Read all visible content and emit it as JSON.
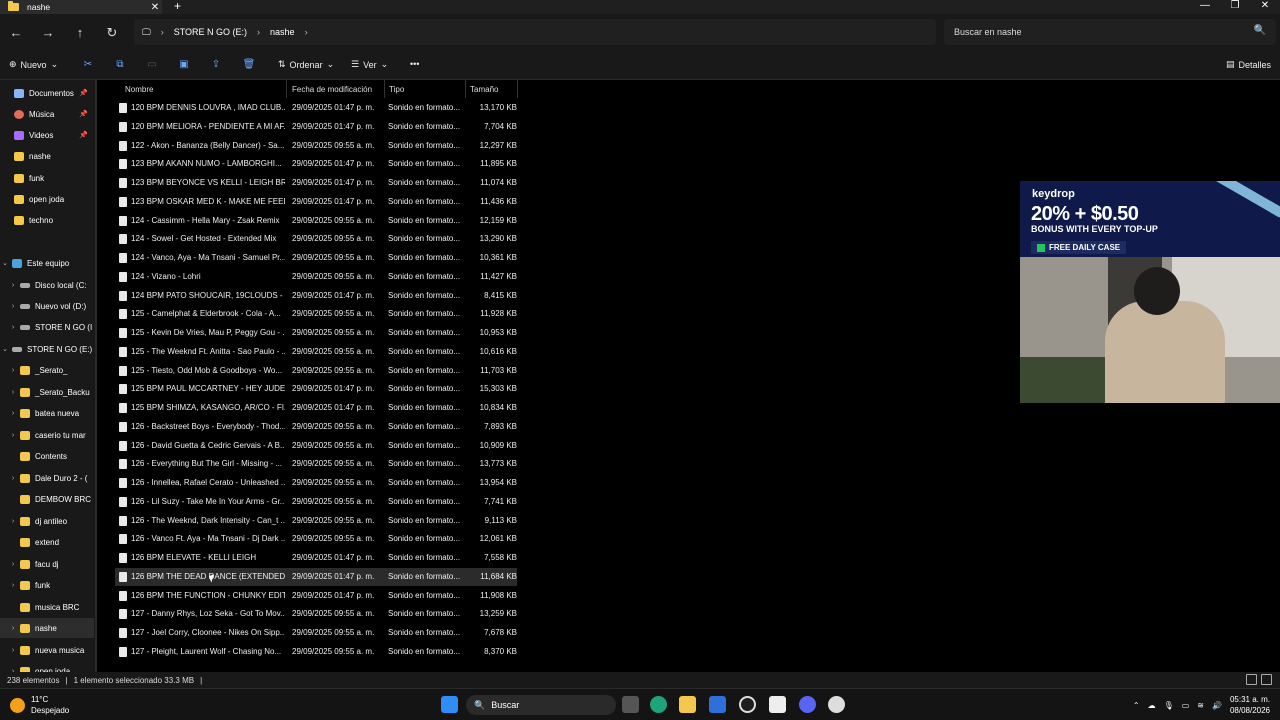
{
  "window": {
    "tab_title": "nashe",
    "tab_close": "✕",
    "new_tab": "+",
    "minimize": "—",
    "maximize": "❐",
    "close": "✕"
  },
  "navbar": {
    "back": "←",
    "forward": "→",
    "up": "↑",
    "refresh": "↻",
    "pc_icon": "🖵",
    "breadcrumb": [
      "STORE N GO (E:)",
      "nashe"
    ],
    "chevron": "›",
    "search_placeholder": "Buscar en nashe",
    "search_icon": "🔍"
  },
  "toolbar": {
    "nuevo": "Nuevo",
    "ordenar": "Ordenar",
    "ver": "Ver",
    "more": "•••",
    "detalles": "Detalles",
    "icons": [
      "cut-icon",
      "copy-icon",
      "paste-icon",
      "rename-icon",
      "share-icon",
      "delete-icon"
    ]
  },
  "sidebar": {
    "items": [
      {
        "label": "Documentos",
        "icon": "doc",
        "pin": true,
        "chev": ""
      },
      {
        "label": "Música",
        "icon": "mus",
        "pin": true,
        "chev": ""
      },
      {
        "label": "Videos",
        "icon": "vid",
        "pin": true,
        "chev": ""
      },
      {
        "label": "nashe",
        "icon": "fold",
        "pin": false,
        "chev": ""
      },
      {
        "label": "funk",
        "icon": "fold",
        "pin": false,
        "chev": ""
      },
      {
        "label": "open joda",
        "icon": "fold",
        "pin": false,
        "chev": ""
      },
      {
        "label": "techno",
        "icon": "fold",
        "pin": false,
        "chev": ""
      },
      {
        "label": "Este equipo",
        "icon": "pc",
        "pin": false,
        "chev": "⌄"
      },
      {
        "label": "Disco local (C:",
        "icon": "drv",
        "pin": false,
        "chev": "›"
      },
      {
        "label": "Nuevo vol (D:)",
        "icon": "drv",
        "pin": false,
        "chev": "›"
      },
      {
        "label": "STORE N GO (I",
        "icon": "drv",
        "pin": false,
        "chev": "›"
      },
      {
        "label": "STORE N GO (E:)",
        "icon": "drv",
        "pin": false,
        "chev": "⌄"
      },
      {
        "label": "_Serato_",
        "icon": "fold",
        "pin": false,
        "chev": "›"
      },
      {
        "label": "_Serato_Backu",
        "icon": "fold",
        "pin": false,
        "chev": "›"
      },
      {
        "label": "batea nueva",
        "icon": "fold",
        "pin": false,
        "chev": "›"
      },
      {
        "label": "caserio tu mar",
        "icon": "fold",
        "pin": false,
        "chev": "›"
      },
      {
        "label": "Contents",
        "icon": "fold",
        "pin": false,
        "chev": ""
      },
      {
        "label": "Dale Duro 2 - (",
        "icon": "fold",
        "pin": false,
        "chev": "›"
      },
      {
        "label": "DEMBOW BRC",
        "icon": "fold",
        "pin": false,
        "chev": ""
      },
      {
        "label": "dj antileo",
        "icon": "fold",
        "pin": false,
        "chev": "›"
      },
      {
        "label": "extend",
        "icon": "fold",
        "pin": false,
        "chev": ""
      },
      {
        "label": "facu dj",
        "icon": "fold",
        "pin": false,
        "chev": "›"
      },
      {
        "label": "funk",
        "icon": "fold",
        "pin": false,
        "chev": "›"
      },
      {
        "label": "musica BRC",
        "icon": "fold",
        "pin": false,
        "chev": ""
      },
      {
        "label": "nashe",
        "icon": "fold",
        "pin": false,
        "chev": "›",
        "selected": true
      },
      {
        "label": "nueva musica",
        "icon": "fold",
        "pin": false,
        "chev": "›"
      },
      {
        "label": "open joda",
        "icon": "fold",
        "pin": false,
        "chev": "›"
      }
    ]
  },
  "columns": {
    "nombre": "Nombre",
    "fecha": "Fecha de modificación",
    "tipo": "Tipo",
    "tamano": "Tamaño"
  },
  "files": [
    {
      "name": "120 BPM DENNIS LOUVRA , IMAD CLUB...",
      "date": "29/09/2025 01:47 p. m.",
      "type": "Sonido en formato...",
      "size": "13,170 KB"
    },
    {
      "name": "120 BPM MELIORA - PENDIENTE A MI AF...",
      "date": "29/09/2025 01:47 p. m.",
      "type": "Sonido en formato...",
      "size": "7,704 KB"
    },
    {
      "name": "122 - Akon - Bananza (Belly Dancer) - Sa...",
      "date": "29/09/2025 09:55 a. m.",
      "type": "Sonido en formato...",
      "size": "12,297 KB"
    },
    {
      "name": "123 BPM AKANN NUMO - LAMBORGHI...",
      "date": "29/09/2025 01:47 p. m.",
      "type": "Sonido en formato...",
      "size": "11,895 KB"
    },
    {
      "name": "123 BPM BEYONCE VS KELLI - LEIGH BRE...",
      "date": "29/09/2025 01:47 p. m.",
      "type": "Sonido en formato...",
      "size": "11,074 KB"
    },
    {
      "name": "123 BPM OSKAR MED K - MAKE ME FEEL ...",
      "date": "29/09/2025 01:47 p. m.",
      "type": "Sonido en formato...",
      "size": "11,436 KB"
    },
    {
      "name": "124 - Cassimm - Hella Mary - Zsak Remix",
      "date": "29/09/2025 09:55 a. m.",
      "type": "Sonido en formato...",
      "size": "12,159 KB"
    },
    {
      "name": "124 - Sowel - Get Hosted - Extended Mix",
      "date": "29/09/2025 09:55 a. m.",
      "type": "Sonido en formato...",
      "size": "13,290 KB"
    },
    {
      "name": "124 - Vanco, Aya - Ma Tnsani - Samuel Pr...",
      "date": "29/09/2025 09:55 a. m.",
      "type": "Sonido en formato...",
      "size": "10,361 KB"
    },
    {
      "name": "124 - Vizano - Lohri",
      "date": "29/09/2025 09:55 a. m.",
      "type": "Sonido en formato...",
      "size": "11,427 KB"
    },
    {
      "name": "124 BPM PATO SHOUCAIR, 19CLOUDS - ...",
      "date": "29/09/2025 01:47 p. m.",
      "type": "Sonido en formato...",
      "size": "8,415 KB"
    },
    {
      "name": "125 - Camelphat & Elderbrook - Cola - A...",
      "date": "29/09/2025 09:55 a. m.",
      "type": "Sonido en formato...",
      "size": "11,928 KB"
    },
    {
      "name": "125 - Kevin De Vries, Mau P, Peggy Gou - ...",
      "date": "29/09/2025 09:55 a. m.",
      "type": "Sonido en formato...",
      "size": "10,953 KB"
    },
    {
      "name": "125 - The Weeknd Ft. Anitta - Sao Paulo - ...",
      "date": "29/09/2025 09:55 a. m.",
      "type": "Sonido en formato...",
      "size": "10,616 KB"
    },
    {
      "name": "125 - Tiesto, Odd Mob & Goodboys - Wo...",
      "date": "29/09/2025 09:55 a. m.",
      "type": "Sonido en formato...",
      "size": "11,703 KB"
    },
    {
      "name": "125 BPM PAUL MCCARTNEY - HEY JUDE ...",
      "date": "29/09/2025 01:47 p. m.",
      "type": "Sonido en formato...",
      "size": "15,303 KB"
    },
    {
      "name": "125 BPM SHIMZA, KASANGO, AR/CO - FI...",
      "date": "29/09/2025 01:47 p. m.",
      "type": "Sonido en formato...",
      "size": "10,834 KB"
    },
    {
      "name": "126 - Backstreet Boys - Everybody - Thod...",
      "date": "29/09/2025 09:55 a. m.",
      "type": "Sonido en formato...",
      "size": "7,893 KB"
    },
    {
      "name": "126 - David Guetta & Cedric Gervais - A B...",
      "date": "29/09/2025 09:55 a. m.",
      "type": "Sonido en formato...",
      "size": "10,909 KB"
    },
    {
      "name": "126 - Everything But The Girl - Missing - ...",
      "date": "29/09/2025 09:55 a. m.",
      "type": "Sonido en formato...",
      "size": "13,773 KB"
    },
    {
      "name": "126 - Innellea, Rafael Cerato - Unleashed ...",
      "date": "29/09/2025 09:55 a. m.",
      "type": "Sonido en formato...",
      "size": "13,954 KB"
    },
    {
      "name": "126 - Lil Suzy - Take Me In Your Arms - Gr...",
      "date": "29/09/2025 09:55 a. m.",
      "type": "Sonido en formato...",
      "size": "7,741 KB"
    },
    {
      "name": "126 - The Weeknd, Dark Intensity - Can_t ...",
      "date": "29/09/2025 09:55 a. m.",
      "type": "Sonido en formato...",
      "size": "9,113 KB"
    },
    {
      "name": "126 - Vanco Ft. Aya - Ma Tnsani - Dj Dark ...",
      "date": "29/09/2025 09:55 a. m.",
      "type": "Sonido en formato...",
      "size": "12,061 KB"
    },
    {
      "name": "126 BPM ELEVATE - KELLI LEIGH",
      "date": "29/09/2025 01:47 p. m.",
      "type": "Sonido en formato...",
      "size": "7,558 KB"
    },
    {
      "name": "126 BPM THE DEAD DANCE (EXTENDED) ...",
      "date": "29/09/2025 01:47 p. m.",
      "type": "Sonido en formato...",
      "size": "11,684 KB",
      "selected": true
    },
    {
      "name": "126 BPM THE FUNCTION - CHUNKY EDIT",
      "date": "29/09/2025 01:47 p. m.",
      "type": "Sonido en formato...",
      "size": "11,908 KB"
    },
    {
      "name": "127 - Danny Rhys, Loz Seka - Got To Mov...",
      "date": "29/09/2025 09:55 a. m.",
      "type": "Sonido en formato...",
      "size": "13,259 KB"
    },
    {
      "name": "127 - Joel Corry, Cloonee - Nikes On Sipp...",
      "date": "29/09/2025 09:55 a. m.",
      "type": "Sonido en formato...",
      "size": "7,678 KB"
    },
    {
      "name": "127 - Pleight, Laurent Wolf - Chasing No...",
      "date": "29/09/2025 09:55 a. m.",
      "type": "Sonido en formato...",
      "size": "8,370 KB"
    }
  ],
  "status": {
    "count": "238 elementos",
    "selection": "1 elemento seleccionado  33.3 MB"
  },
  "taskbar": {
    "temp": "11°C",
    "weather": "Despejado",
    "search": "Buscar",
    "time": "05:31 a. m.",
    "date": "08/08/2026"
  },
  "overlay": {
    "brand": "keydrop",
    "headline": "20% + $0.50",
    "sub": "BONUS WITH EVERY TOP-UP",
    "cta": "FREE DAILY CASE"
  }
}
